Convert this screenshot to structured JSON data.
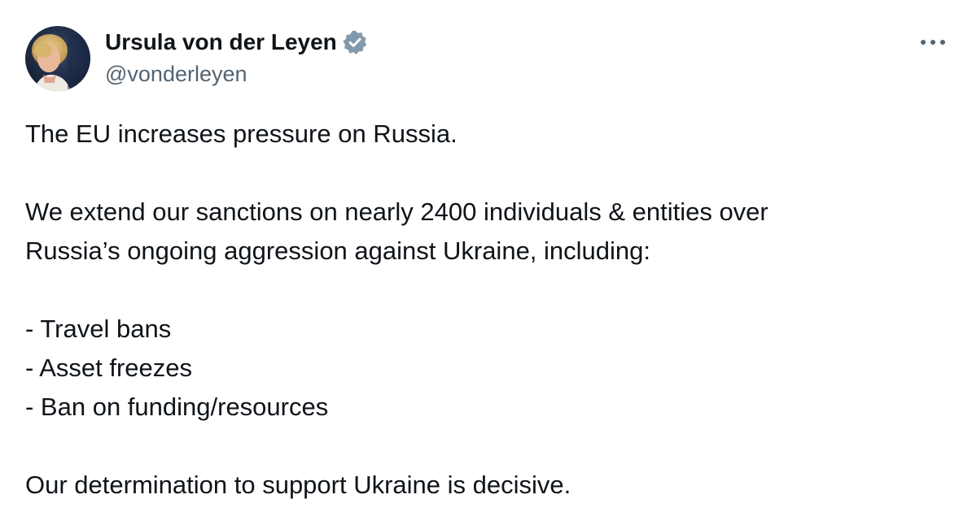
{
  "author": {
    "display_name": "Ursula von der Leyen",
    "handle": "@vonderleyen",
    "verified": true,
    "avatar_icon": "profile-photo",
    "verified_icon": "verified-badge-icon"
  },
  "menu": {
    "more_icon": "more-options-icon"
  },
  "tweet": {
    "line1": "The EU increases pressure on Russia.",
    "line2": "We extend our sanctions on nearly 2400 individuals & entities over",
    "line3": "Russia’s ongoing aggression against Ukraine, including:",
    "list": [
      "- Travel bans",
      "- Asset freezes",
      "- Ban on funding/resources"
    ],
    "line4": "Our determination to support Ukraine is decisive."
  },
  "colors": {
    "text": "#0f1419",
    "secondary_text": "#536471",
    "badge": "#829aab",
    "background": "#ffffff"
  }
}
